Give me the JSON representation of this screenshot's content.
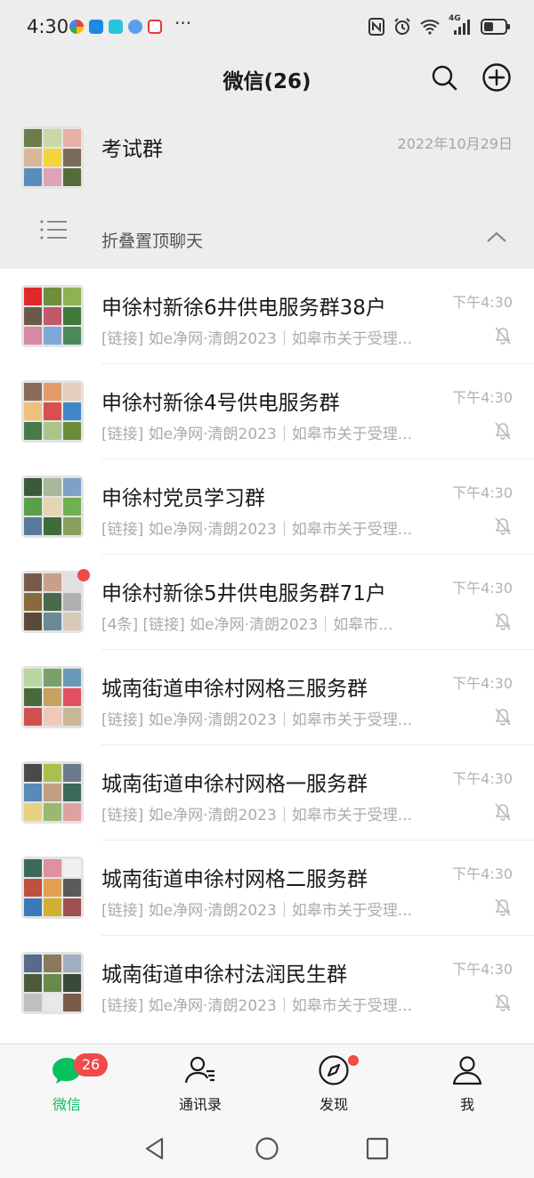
{
  "status_bar": {
    "time": "4:30",
    "more": "···",
    "icons": [
      "nfc-icon",
      "alarm-icon",
      "wifi-icon",
      "signal-4g-icon",
      "battery-icon"
    ],
    "network_label": "4G"
  },
  "header": {
    "title": "微信(26)",
    "search_icon": "search-icon",
    "add_icon": "add-circle-icon"
  },
  "pinned": {
    "name": "考试群",
    "time": "2022年10月29日",
    "fold_label": "折叠置顶聊天"
  },
  "chats": [
    {
      "name": "申徐村新徐6井供电服务群38户",
      "preview": "[链接] 如e净网·清朗2023｜如皋市关于受理...",
      "time": "下午4:30",
      "muted": true,
      "unread_dot": false
    },
    {
      "name": "申徐村新徐4号供电服务群",
      "preview": "[链接] 如e净网·清朗2023｜如皋市关于受理...",
      "time": "下午4:30",
      "muted": true,
      "unread_dot": false
    },
    {
      "name": "申徐村党员学习群",
      "preview": "[链接] 如e净网·清朗2023｜如皋市关于受理...",
      "time": "下午4:30",
      "muted": true,
      "unread_dot": false
    },
    {
      "name": "申徐村新徐5井供电服务群71户",
      "preview": "[4条] [链接] 如e净网·清朗2023｜如皋市...",
      "time": "下午4:30",
      "muted": true,
      "unread_dot": true
    },
    {
      "name": "城南街道申徐村网格三服务群",
      "preview": "[链接] 如e净网·清朗2023｜如皋市关于受理...",
      "time": "下午4:30",
      "muted": true,
      "unread_dot": false
    },
    {
      "name": "城南街道申徐村网格一服务群",
      "preview": "[链接] 如e净网·清朗2023｜如皋市关于受理...",
      "time": "下午4:30",
      "muted": true,
      "unread_dot": false
    },
    {
      "name": "城南街道申徐村网格二服务群",
      "preview": "[链接] 如e净网·清朗2023｜如皋市关于受理...",
      "time": "下午4:30",
      "muted": true,
      "unread_dot": false
    },
    {
      "name": "城南街道申徐村法润民生群",
      "preview": "[链接] 如e净网·清朗2023｜如皋市关于受理...",
      "time": "下午4:30",
      "muted": true,
      "unread_dot": false
    }
  ],
  "tabbar": {
    "tabs": [
      {
        "label": "微信",
        "badge": "26",
        "active": true,
        "icon": "chat-bubble-icon"
      },
      {
        "label": "通讯录",
        "active": false,
        "icon": "contacts-icon"
      },
      {
        "label": "发现",
        "active": false,
        "dot": true,
        "icon": "compass-icon"
      },
      {
        "label": "我",
        "active": false,
        "icon": "person-icon"
      }
    ]
  },
  "colors": {
    "accent": "#07c160",
    "badge": "#f04a4a",
    "header_bg": "#ededed",
    "muted_text": "#ababab"
  }
}
